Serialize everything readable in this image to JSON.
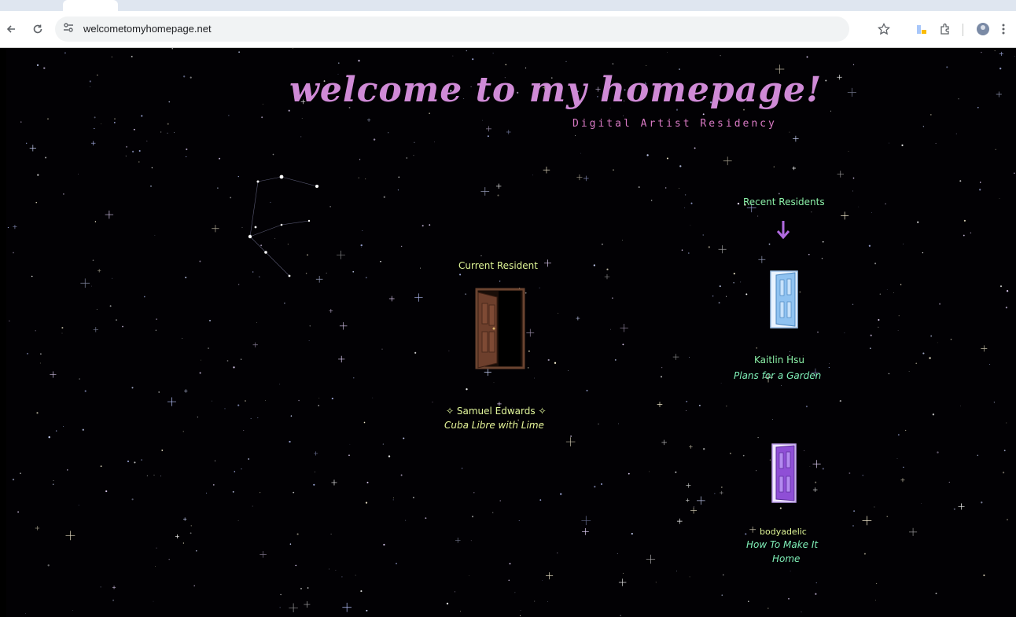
{
  "browser": {
    "url": "welcometomyhomepage.net"
  },
  "page": {
    "title": "welcome to my homepage!",
    "subtitle": "Digital Artist Residency",
    "current": {
      "heading": "Current Resident",
      "name": "✧ Samuel Edwards ✧",
      "work": "Cuba Libre with Lime"
    },
    "recent": {
      "heading": "Recent Residents",
      "residents": [
        {
          "name": "Kaitlin Hsu",
          "work": "Plans for a Garden"
        },
        {
          "name": "bodyadelic",
          "work_line1": "How To Make It",
          "work_line2": "Home"
        }
      ]
    }
  },
  "colors": {
    "title": "#cf8ad6",
    "subtitle": "#d879c4",
    "label": "#dff596",
    "accent_green": "#8bf0a8",
    "arrow": "#b06adf"
  },
  "icons": [
    "back-arrow-icon",
    "reload-icon",
    "site-info-icon",
    "star-icon",
    "extension-icon",
    "profile-icon",
    "menu-icon"
  ]
}
